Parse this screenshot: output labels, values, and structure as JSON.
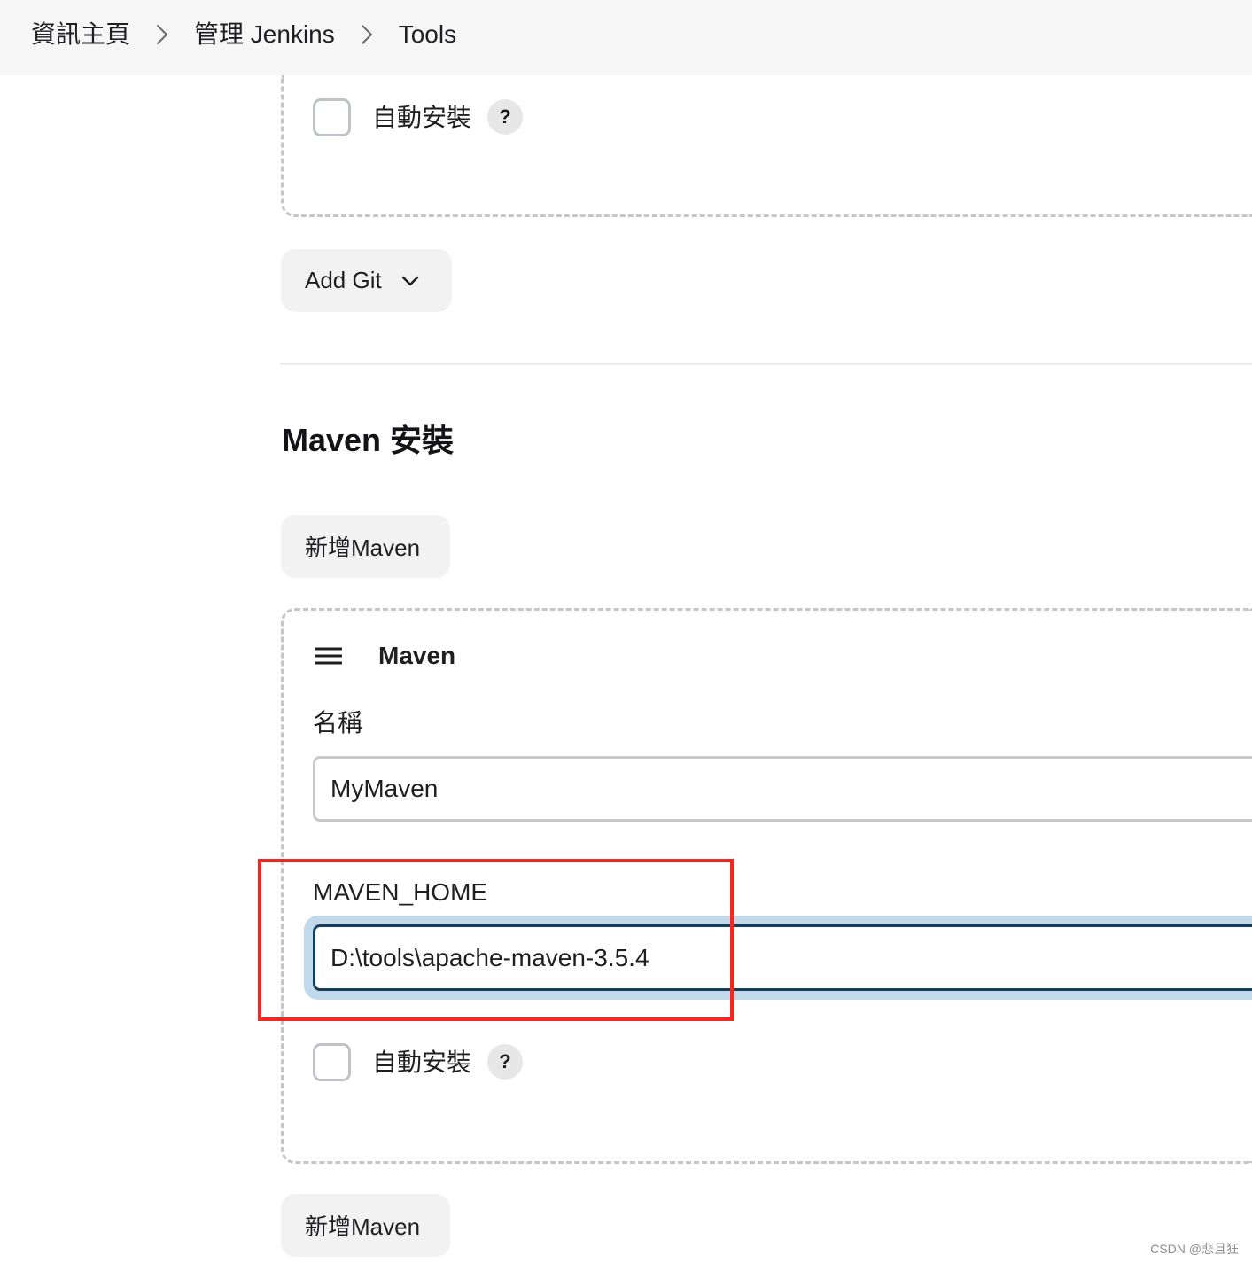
{
  "breadcrumb": {
    "separator_icon": "chevron-right-icon",
    "items": [
      {
        "label": "資訊主頁"
      },
      {
        "label": "管理 Jenkins"
      },
      {
        "label": "Tools"
      }
    ]
  },
  "git_section": {
    "auto_install": {
      "label": "自動安裝",
      "checked": false,
      "help": "?"
    },
    "add_button": {
      "label": "Add Git",
      "icon": "chevron-down-icon"
    }
  },
  "maven_section": {
    "title": "Maven 安裝",
    "add_button_top": {
      "label": "新增Maven"
    },
    "installation": {
      "title": "Maven",
      "handle_icon": "drag-handle-icon",
      "name": {
        "label": "名稱",
        "value": "MyMaven"
      },
      "home": {
        "label": "MAVEN_HOME",
        "value": "D:\\tools\\apache-maven-3.5.4"
      },
      "auto_install": {
        "label": "自動安裝",
        "checked": false,
        "help": "?"
      }
    },
    "add_button_bottom": {
      "label": "新增Maven"
    }
  },
  "watermark": "CSDN @悲且狂",
  "colors": {
    "header_bg": "#f6f6f7",
    "focus_border": "#153e5c",
    "focus_ring": "#c2d9eb",
    "annotation": "#ef2a22"
  }
}
